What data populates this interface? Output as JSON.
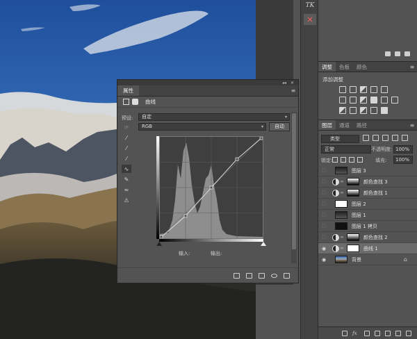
{
  "tool_strip": {
    "tk_label": "TK",
    "x_label": "✕"
  },
  "adjustments_tabs": [
    {
      "label": "调整",
      "active": true
    },
    {
      "label": "色板",
      "active": false
    },
    {
      "label": "颜色",
      "active": false
    }
  ],
  "adjustments_title": "添加调整",
  "layers_tabs": [
    {
      "label": "图层",
      "active": true
    },
    {
      "label": "通道",
      "active": false
    },
    {
      "label": "路径",
      "active": false
    }
  ],
  "layers": {
    "filter_label": "类型",
    "blend_mode": "正常",
    "opacity_label": "不透明度:",
    "opacity_value": "100%",
    "lock_label": "锁定:",
    "fill_label": "填充:",
    "fill_value": "100%",
    "items": [
      {
        "name": "图层 3",
        "visible": false,
        "thumb": "dark",
        "adjustment": false,
        "selected": false,
        "locked": false
      },
      {
        "name": "颜色查找 3",
        "visible": false,
        "thumb": "grad",
        "adjustment": true,
        "selected": false,
        "locked": false
      },
      {
        "name": "颜色查找 1",
        "visible": false,
        "thumb": "grad",
        "adjustment": true,
        "selected": false,
        "locked": false
      },
      {
        "name": "图层 2",
        "visible": false,
        "thumb": "white",
        "adjustment": false,
        "selected": false,
        "locked": false
      },
      {
        "name": "图层 1",
        "visible": false,
        "thumb": "dark",
        "adjustment": false,
        "selected": false,
        "locked": false
      },
      {
        "name": "图层 1 拷贝",
        "visible": false,
        "thumb": "black",
        "adjustment": false,
        "selected": false,
        "locked": false
      },
      {
        "name": "颜色查找 2",
        "visible": false,
        "thumb": "grad",
        "adjustment": true,
        "selected": false,
        "locked": false
      },
      {
        "name": "曲线 1",
        "visible": true,
        "thumb": "white",
        "adjustment": true,
        "selected": true,
        "locked": false
      },
      {
        "name": "背景",
        "visible": true,
        "thumb": "scene",
        "adjustment": false,
        "selected": false,
        "locked": true
      }
    ]
  },
  "properties": {
    "tab_label": "属性",
    "title": "曲线",
    "preset_label": "预设:",
    "preset_value": "自定",
    "channel_value": "RGB",
    "auto_label": "自动",
    "input_label": "输入:",
    "output_label": "输出:",
    "curve_points": [
      [
        0,
        0
      ],
      [
        0.25,
        0.22
      ],
      [
        0.5,
        0.5
      ],
      [
        0.75,
        0.78
      ],
      [
        1,
        1
      ]
    ]
  }
}
